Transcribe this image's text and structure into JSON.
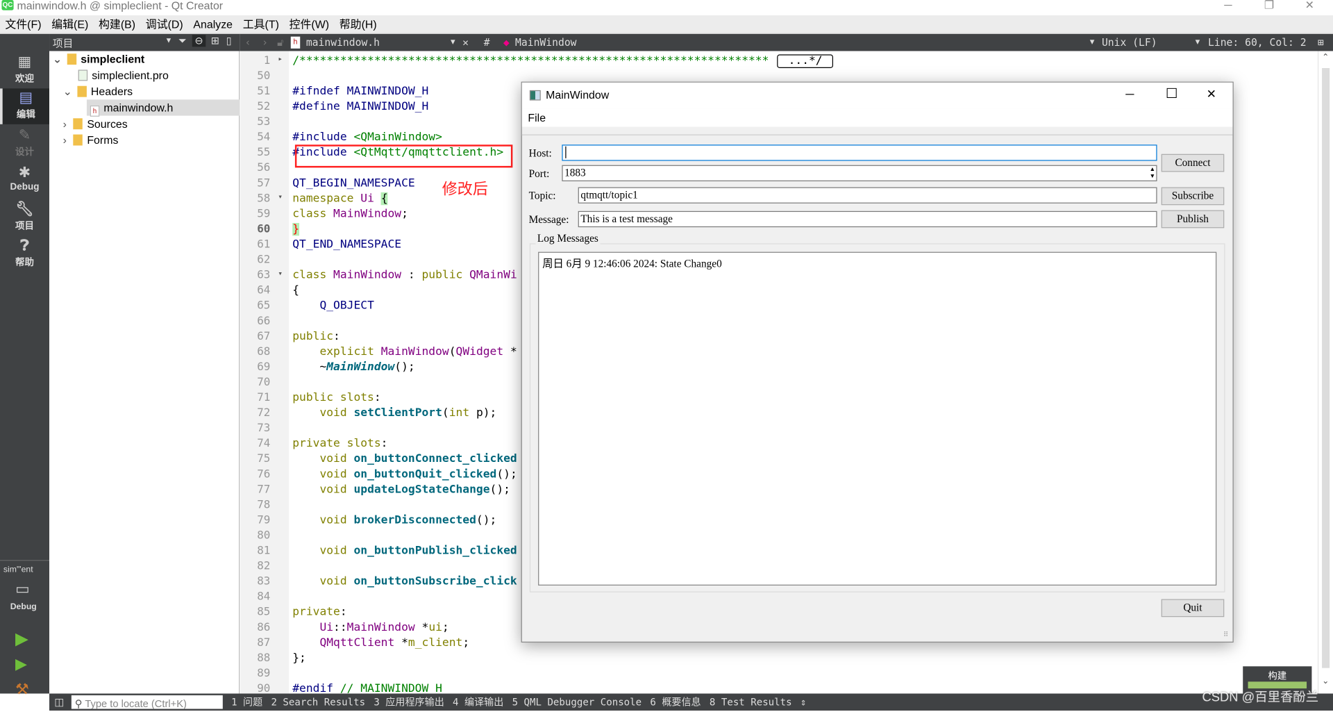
{
  "window": {
    "title": "mainwindow.h @ simpleclient - Qt Creator",
    "minimize": "─",
    "restore": "❐",
    "close": "✕"
  },
  "menu": [
    "文件(F)",
    "编辑(E)",
    "构建(B)",
    "调试(D)",
    "Analyze",
    "工具(T)",
    "控件(W)",
    "帮助(H)"
  ],
  "modes": [
    {
      "label": "欢迎",
      "icon": "grid-icon"
    },
    {
      "label": "编辑",
      "icon": "edit-icon"
    },
    {
      "label": "设计",
      "icon": "pencil-icon"
    },
    {
      "label": "Debug",
      "icon": "bug-icon"
    },
    {
      "label": "项目",
      "icon": "wrench-icon"
    },
    {
      "label": "帮助",
      "icon": "help-icon"
    }
  ],
  "kit": {
    "name": "sim\"'ent",
    "target": "Debug"
  },
  "project_pane": {
    "title": "项目",
    "tree": [
      {
        "label": "simpleclient",
        "level": 0,
        "expanded": true,
        "bold": true
      },
      {
        "label": "simpleclient.pro",
        "level": 1
      },
      {
        "label": "Headers",
        "level": 1,
        "expanded": true
      },
      {
        "label": "mainwindow.h",
        "level": 2,
        "selected": true
      },
      {
        "label": "Sources",
        "level": 1,
        "expanded": false
      },
      {
        "label": "Forms",
        "level": 1,
        "expanded": false
      }
    ]
  },
  "editor": {
    "file": "mainwindow.h",
    "symbol_hash": "#",
    "symbol": "MainWindow",
    "line_ending": "Unix (LF)",
    "position": "Line: 60, Col: 2",
    "current_line": 60,
    "lines": [
      {
        "n": 1,
        "fold": "▸",
        "s": [
          [
            "cm",
            "/*********************************************************************"
          ],
          [
            "box",
            "...*/"
          ]
        ]
      },
      {
        "n": 50,
        "s": []
      },
      {
        "n": 51,
        "s": [
          [
            "pp",
            "#ifndef "
          ],
          [
            "mc",
            "MAINWINDOW_H"
          ]
        ]
      },
      {
        "n": 52,
        "s": [
          [
            "pp",
            "#define "
          ],
          [
            "mc",
            "MAINWINDOW_H"
          ]
        ]
      },
      {
        "n": 53,
        "s": []
      },
      {
        "n": 54,
        "s": [
          [
            "pp",
            "#include "
          ],
          [
            "st",
            "<QMainWindow>"
          ]
        ]
      },
      {
        "n": 55,
        "s": [
          [
            "pp",
            "#include "
          ],
          [
            "st",
            "<QtMqtt/qmqttclient.h>"
          ]
        ]
      },
      {
        "n": 56,
        "s": []
      },
      {
        "n": 57,
        "s": [
          [
            "mc",
            "QT_BEGIN_NAMESPACE"
          ]
        ]
      },
      {
        "n": 58,
        "fold": "▾",
        "s": [
          [
            "kw",
            "namespace "
          ],
          [
            "ty",
            "Ui "
          ],
          [
            "hl",
            "{"
          ]
        ]
      },
      {
        "n": 59,
        "s": [
          [
            "kw",
            "class "
          ],
          [
            "ty",
            "MainWindow"
          ],
          [
            "pl",
            ";"
          ]
        ]
      },
      {
        "n": 60,
        "s": [
          [
            "br",
            "}"
          ]
        ]
      },
      {
        "n": 61,
        "s": [
          [
            "mc",
            "QT_END_NAMESPACE"
          ]
        ]
      },
      {
        "n": 62,
        "s": []
      },
      {
        "n": 63,
        "fold": "▾",
        "s": [
          [
            "kw",
            "class "
          ],
          [
            "ty",
            "MainWindow "
          ],
          [
            "pl",
            ": "
          ],
          [
            "kw",
            "public "
          ],
          [
            "ty",
            "QMainWi"
          ]
        ]
      },
      {
        "n": 64,
        "s": [
          [
            "pl",
            "{"
          ]
        ]
      },
      {
        "n": 65,
        "s": [
          [
            "pl",
            "    "
          ],
          [
            "mc",
            "Q_OBJECT"
          ]
        ]
      },
      {
        "n": 66,
        "s": []
      },
      {
        "n": 67,
        "s": [
          [
            "kw",
            "public"
          ],
          [
            "pl",
            ":"
          ]
        ]
      },
      {
        "n": 68,
        "s": [
          [
            "pl",
            "    "
          ],
          [
            "kw",
            "explicit "
          ],
          [
            "ty",
            "MainWindow"
          ],
          [
            "pl",
            "("
          ],
          [
            "ty",
            "QWidget "
          ],
          [
            "pl",
            "*"
          ]
        ]
      },
      {
        "n": 69,
        "s": [
          [
            "pl",
            "    ~"
          ],
          [
            "it",
            "MainWindow"
          ],
          [
            "pl",
            "();"
          ]
        ]
      },
      {
        "n": 70,
        "s": []
      },
      {
        "n": 71,
        "s": [
          [
            "kw",
            "public slots"
          ],
          [
            "pl",
            ":"
          ]
        ]
      },
      {
        "n": 72,
        "s": [
          [
            "pl",
            "    "
          ],
          [
            "kw",
            "void "
          ],
          [
            "fn",
            "setClientPort"
          ],
          [
            "pl",
            "("
          ],
          [
            "kw",
            "int "
          ],
          [
            "pl",
            "p);"
          ]
        ]
      },
      {
        "n": 73,
        "s": []
      },
      {
        "n": 74,
        "s": [
          [
            "kw",
            "private slots"
          ],
          [
            "pl",
            ":"
          ]
        ]
      },
      {
        "n": 75,
        "s": [
          [
            "pl",
            "    "
          ],
          [
            "kw",
            "void "
          ],
          [
            "fn",
            "on_buttonConnect_clicked"
          ]
        ]
      },
      {
        "n": 76,
        "s": [
          [
            "pl",
            "    "
          ],
          [
            "kw",
            "void "
          ],
          [
            "fn",
            "on_buttonQuit_clicked"
          ],
          [
            "pl",
            "();"
          ]
        ]
      },
      {
        "n": 77,
        "s": [
          [
            "pl",
            "    "
          ],
          [
            "kw",
            "void "
          ],
          [
            "fn",
            "updateLogStateChange"
          ],
          [
            "pl",
            "();"
          ]
        ]
      },
      {
        "n": 78,
        "s": []
      },
      {
        "n": 79,
        "s": [
          [
            "pl",
            "    "
          ],
          [
            "kw",
            "void "
          ],
          [
            "fn",
            "brokerDisconnected"
          ],
          [
            "pl",
            "();"
          ]
        ]
      },
      {
        "n": 80,
        "s": []
      },
      {
        "n": 81,
        "s": [
          [
            "pl",
            "    "
          ],
          [
            "kw",
            "void "
          ],
          [
            "fn",
            "on_buttonPublish_clicked"
          ]
        ]
      },
      {
        "n": 82,
        "s": []
      },
      {
        "n": 83,
        "s": [
          [
            "pl",
            "    "
          ],
          [
            "kw",
            "void "
          ],
          [
            "fn",
            "on_buttonSubscribe_click"
          ]
        ]
      },
      {
        "n": 84,
        "s": []
      },
      {
        "n": 85,
        "s": [
          [
            "kw",
            "private"
          ],
          [
            "pl",
            ":"
          ]
        ]
      },
      {
        "n": 86,
        "s": [
          [
            "pl",
            "    "
          ],
          [
            "ty",
            "Ui"
          ],
          [
            "pl",
            "::"
          ],
          [
            "ty",
            "MainWindow "
          ],
          [
            "pl",
            "*"
          ],
          [
            "kw",
            "ui"
          ],
          [
            "pl",
            ";"
          ]
        ]
      },
      {
        "n": 87,
        "s": [
          [
            "pl",
            "    "
          ],
          [
            "ty",
            "QMqttClient "
          ],
          [
            "pl",
            "*"
          ],
          [
            "kw",
            "m_client"
          ],
          [
            "pl",
            ";"
          ]
        ]
      },
      {
        "n": 88,
        "s": [
          [
            "pl",
            "};"
          ]
        ]
      },
      {
        "n": 89,
        "s": []
      },
      {
        "n": 90,
        "s": [
          [
            "pp",
            "#endif "
          ],
          [
            "cm",
            "// MAINWINDOW_H"
          ]
        ]
      }
    ]
  },
  "annotation": {
    "text": "修改后",
    "color": "#ff2020"
  },
  "dialog": {
    "title": "MainWindow",
    "menu": "File",
    "host_label": "Host:",
    "host_value": "",
    "port_label": "Port:",
    "port_value": "1883",
    "topic_label": "Topic:",
    "topic_value": "qtmqtt/topic1",
    "message_label": "Message:",
    "message_value": "This is a test message",
    "connect": "Connect",
    "subscribe": "Subscribe",
    "publish": "Publish",
    "log_title": "Log Messages",
    "log": [
      "周日 6月 9 12:46:06 2024: State Change0"
    ],
    "quit": "Quit",
    "minimize": "─",
    "maximize": "☐",
    "close": "✕"
  },
  "statusbar": {
    "locate_placeholder": "Type to locate (Ctrl+K)",
    "tabs": [
      "1 问题",
      "2 Search Results",
      "3 应用程序输出",
      "4 编译输出",
      "5 QML Debugger Console",
      "6 概要信息",
      "8 Test Results"
    ]
  },
  "build": {
    "label": "构建",
    "progress": 100,
    "color": "#9bc46a"
  },
  "watermark": "CSDN @百里香酚兰"
}
